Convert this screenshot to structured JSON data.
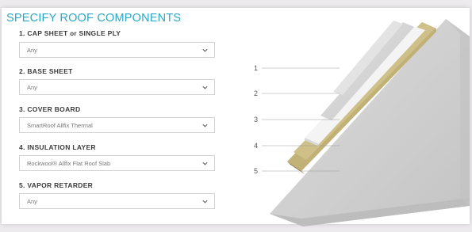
{
  "page": {
    "title": "SPECIFY ROOF COMPONENTS"
  },
  "components": [
    {
      "label": "1. CAP SHEET or SINGLE PLY",
      "label_main": "1. CAP SHEET ",
      "label_small": "or",
      "label_rest": " SINGLE PLY",
      "value": "Any"
    },
    {
      "label": "2. BASE SHEET",
      "value": "Any"
    },
    {
      "label": "3. COVER BOARD",
      "value": "SmartRoof Allfix Thermal"
    },
    {
      "label": "4. INSULATION LAYER",
      "value": "Rockwool® Allfix Flat Roof Slab"
    },
    {
      "label": "5. VAPOR RETARDER",
      "value": "Any"
    }
  ],
  "diagram": {
    "layer_numbers": [
      "1",
      "2",
      "3",
      "4",
      "5"
    ],
    "colors": {
      "layer_gray": "#d3d3d3",
      "layer_light": "#e6e6e6",
      "insulation": "#c9b87a",
      "insulation_dark": "#a8985c",
      "concrete": "#cfcfcf"
    }
  },
  "icons": {
    "chevron": "chevron-down-icon"
  },
  "accent_color": "#28a8c8"
}
